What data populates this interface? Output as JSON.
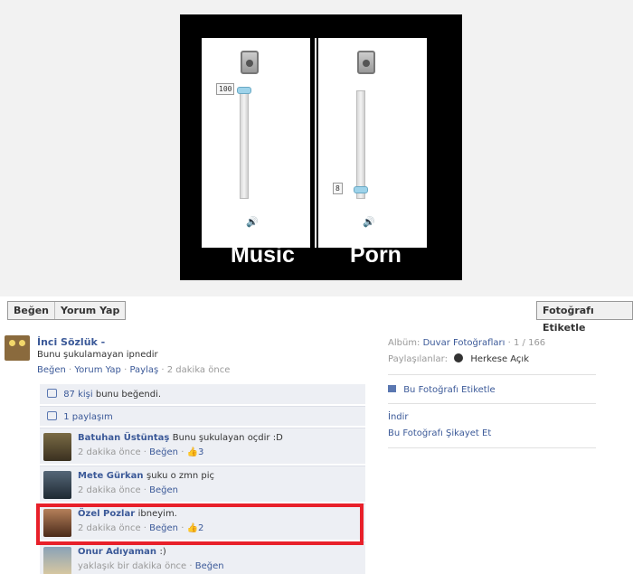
{
  "meme": {
    "left_label": "Music",
    "right_label": "Porn",
    "left_value": "100",
    "right_value": "8",
    "left_level": 1.0,
    "right_level": 0.08
  },
  "actions": {
    "like": "Beğen",
    "comment": "Yorum Yap",
    "tag_photo": "Fotoğrafı Etiketle"
  },
  "post": {
    "author": "İnci Sözlük -",
    "text": "Bunu şukulamayan ipnedir",
    "meta_like": "Beğen",
    "meta_comment": "Yorum Yap",
    "meta_share": "Paylaş",
    "meta_time": "2 dakika önce"
  },
  "likes": {
    "count_link": "87 kişi",
    "suffix": "bunu beğendi."
  },
  "shares": {
    "label": "1 paylaşım"
  },
  "comments": [
    {
      "name": "Batuhan Üstüntaş",
      "text": "Bunu şukulayan oçdir :D",
      "time": "2 dakika önce",
      "like": "Beğen",
      "likes": "3"
    },
    {
      "name": "Mete Gürkan",
      "text": "şuku o zmn piç",
      "time": "2 dakika önce",
      "like": "Beğen",
      "likes": ""
    },
    {
      "name": "Özel Pozlar",
      "text": "ibneyim.",
      "time": "2 dakika önce",
      "like": "Beğen",
      "likes": "2"
    },
    {
      "name": "Onur Adıyaman",
      "text": ":)",
      "time": "yaklaşık bir dakika önce",
      "like": "Beğen",
      "likes": ""
    }
  ],
  "sidebar": {
    "album_label": "Albüm:",
    "album_name": "Duvar Fotoğrafları",
    "album_count": "· 1 / 166",
    "sharers_label": "Paylaşılanlar:",
    "sharers_value": "Herkese Açık",
    "tag_link": "Bu Fotoğrafı Etiketle",
    "download": "İndir",
    "report": "Bu Fotoğrafı Şikayet Et"
  },
  "colors": {
    "link": "#3b5998",
    "highlight": "#e8202a",
    "panel_bg": "#edeff4"
  }
}
